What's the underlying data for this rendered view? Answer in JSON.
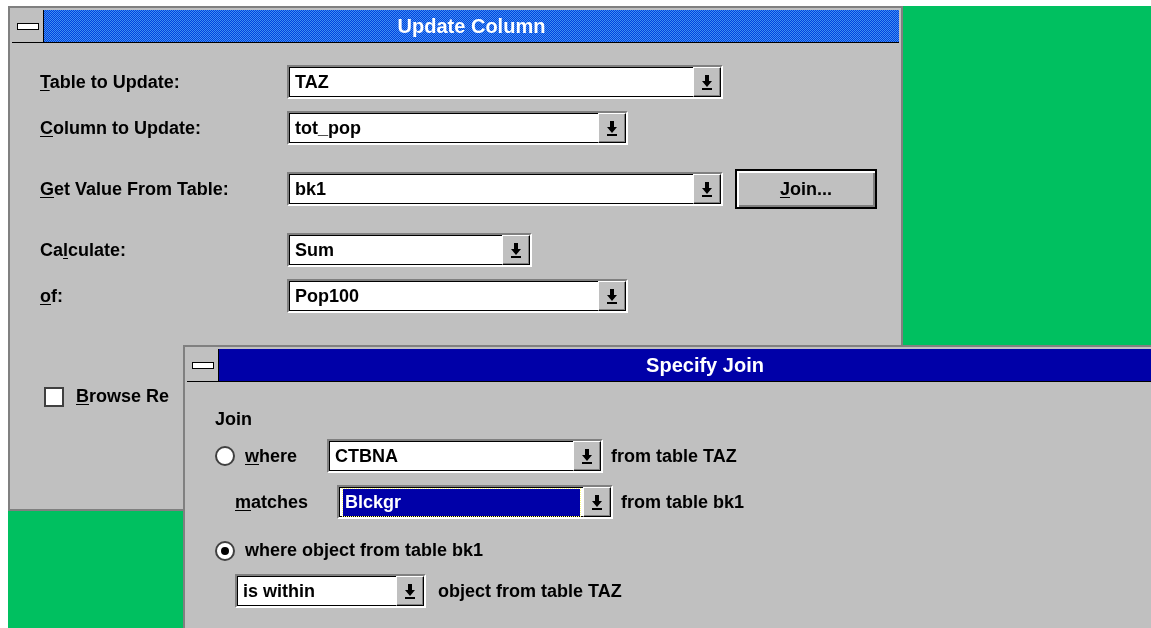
{
  "update_window": {
    "title": "Update Column",
    "fields": [
      {
        "label": {
          "key": "T",
          "after": "able to Update:"
        },
        "value": "TAZ"
      },
      {
        "label": {
          "key": "C",
          "after": "olumn to Update:"
        },
        "value": "tot_pop"
      },
      {
        "label": {
          "key": "G",
          "after": "et Value From Table:"
        },
        "value": "bk1",
        "button": {
          "key": "J",
          "after": "oin..."
        }
      },
      {
        "label": {
          "before": "Ca",
          "key": "l",
          "after": "culate:"
        },
        "value": "Sum"
      },
      {
        "label": {
          "key": "o",
          "after": "f:"
        },
        "value": "Pop100"
      }
    ],
    "checkbox": {
      "label": {
        "key": "B",
        "after": "rowse Re"
      },
      "checked": false
    }
  },
  "join_window": {
    "title": "Specify Join",
    "group_label": "Join",
    "options": [
      {
        "selected": false,
        "label": {
          "key": "w",
          "after": "here"
        },
        "value": "CTBNA",
        "suffix": "from table TAZ",
        "highlighted": false,
        "match": {
          "label": {
            "key": "m",
            "after": "atches"
          },
          "value": "Blckgr",
          "suffix": "from table bk1",
          "highlighted": true
        }
      },
      {
        "selected": true,
        "label": {
          "before": "where object from table bk1"
        },
        "value": "is within",
        "suffix": "object from table TAZ",
        "highlighted": false
      }
    ]
  }
}
